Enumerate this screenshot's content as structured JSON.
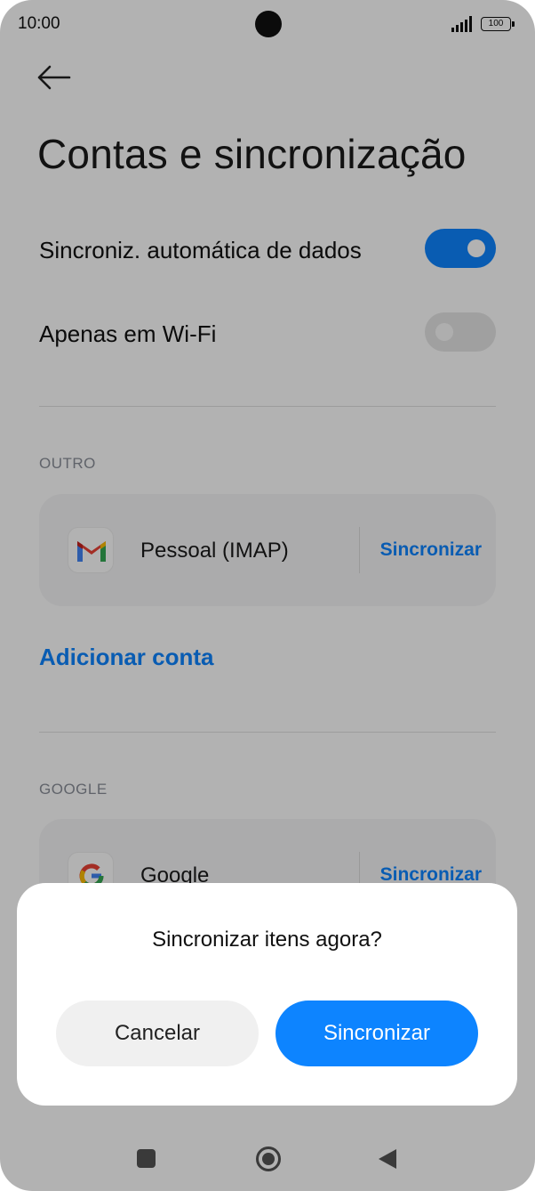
{
  "status_bar": {
    "time": "10:00",
    "battery": "100"
  },
  "header": {
    "back_icon": "arrow-left-icon",
    "title": "Contas e sincronização"
  },
  "settings": {
    "auto_sync": {
      "label": "Sincroniz. automática de dados",
      "enabled": true
    },
    "wifi_only": {
      "label": "Apenas em Wi-Fi",
      "enabled": false
    }
  },
  "sections": {
    "outro": {
      "header": "OUTRO",
      "account": {
        "name": "Pessoal (IMAP)",
        "icon": "gmail-icon",
        "action": "Sincronizar"
      }
    },
    "add_account": "Adicionar conta",
    "google": {
      "header": "GOOGLE",
      "account": {
        "name": "Google",
        "icon": "google-icon",
        "action": "Sincronizar"
      }
    }
  },
  "dialog": {
    "title": "Sincronizar itens agora?",
    "cancel_label": "Cancelar",
    "confirm_label": "Sincronizar"
  },
  "colors": {
    "accent": "#0d84ff",
    "card_bg": "#f5f5f7",
    "scrim": "rgba(0,0,0,0.30)"
  },
  "nav_bar": {
    "recents_icon": "square-icon",
    "home_icon": "home-circle-icon",
    "back_icon": "triangle-back-icon"
  }
}
